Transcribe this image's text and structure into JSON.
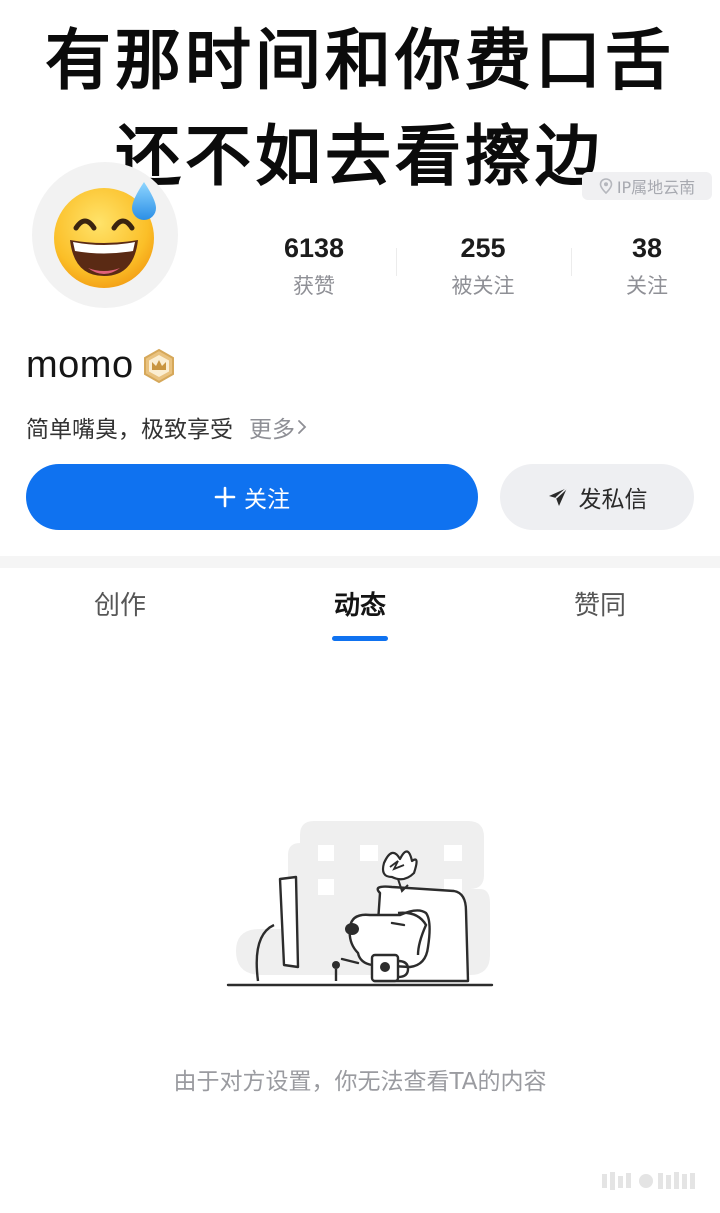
{
  "meme": {
    "line1": "有那时间和你费口舌",
    "line2": "还不如去看擦边"
  },
  "profile": {
    "ip_location": "IP属地云南",
    "avatar_icon": "grinning-face-with-sweat-emoji",
    "username": "momo",
    "level_icon": "crown-level-badge-icon",
    "bio": "简单嘴臭，极致享受",
    "more_label": "更多"
  },
  "stats": [
    {
      "value": "6138",
      "label": "获赞"
    },
    {
      "value": "255",
      "label": "被关注"
    },
    {
      "value": "38",
      "label": "关注"
    }
  ],
  "actions": {
    "follow_label": "关注",
    "message_label": "发私信"
  },
  "tabs": [
    {
      "label": "创作"
    },
    {
      "label": "动态",
      "active": true
    },
    {
      "label": "赞同"
    }
  ],
  "empty_state": {
    "illustration": "dog-at-computer-illustration",
    "message": "由于对方设置，你无法查看TA的内容"
  },
  "colors": {
    "accent": "#0f72f0",
    "secondary_button": "#eeeff2",
    "muted_text": "#8f9096"
  }
}
